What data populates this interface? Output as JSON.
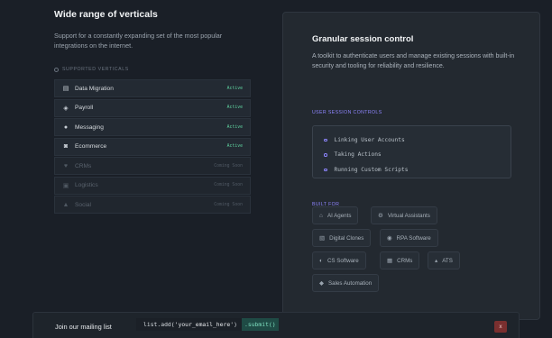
{
  "left": {
    "title": "Wide range of verticals",
    "description": "Support for a constantly expanding set of the most popular integrations on the internet.",
    "section_label": "SUPPORTED VERTICALS",
    "verticals": [
      {
        "label": "Data Migration",
        "status": "Active",
        "icon": "database-icon",
        "dim": false
      },
      {
        "label": "Payroll",
        "status": "Active",
        "icon": "money-icon",
        "dim": false
      },
      {
        "label": "Messaging",
        "status": "Active",
        "icon": "chat-icon",
        "dim": false
      },
      {
        "label": "Ecommerce",
        "status": "Active",
        "icon": "shop-icon",
        "dim": false
      },
      {
        "label": "CRMs",
        "status": "Coming Soon",
        "icon": "handshake-icon",
        "dim": true
      },
      {
        "label": "Logistics",
        "status": "Coming Soon",
        "icon": "truck-icon",
        "dim": true
      },
      {
        "label": "Social",
        "status": "Coming Soon",
        "icon": "users-icon",
        "dim": true
      }
    ]
  },
  "panel": {
    "title": "Granular session control",
    "description": "A toolkit to authenticate users and manage existing sessions with built-in security and tooling for reliability and resilience.",
    "controls_label": "USER SESSION CONTROLS",
    "controls": [
      "Linking User Accounts",
      "Taking Actions",
      "Running Custom Scripts"
    ],
    "built_for_label": "BUILT FOR",
    "built_for": [
      {
        "label": "AI Agents",
        "icon": "robot-icon"
      },
      {
        "label": "Virtual Assistants",
        "icon": "gear-icon"
      },
      {
        "label": "Digital Clones",
        "icon": "clone-icon"
      },
      {
        "label": "RPA Software",
        "icon": "rpa-icon"
      },
      {
        "label": "CS Software",
        "icon": "headset-icon"
      },
      {
        "label": "CRMs",
        "icon": "grid-icon"
      },
      {
        "label": "ATS",
        "icon": "person-icon"
      },
      {
        "label": "Sales Automation",
        "icon": "tag-icon"
      }
    ]
  },
  "mailing": {
    "label": "Join our mailing list",
    "code_prefix": "list.add(",
    "code_string": "'your_email_here'",
    "code_suffix": ")",
    "submit": ".submit()",
    "close": "x"
  },
  "colors": {
    "accent_green": "#5fd3a0",
    "accent_purple": "#8f86ff",
    "close_red": "#7a2f2f"
  }
}
